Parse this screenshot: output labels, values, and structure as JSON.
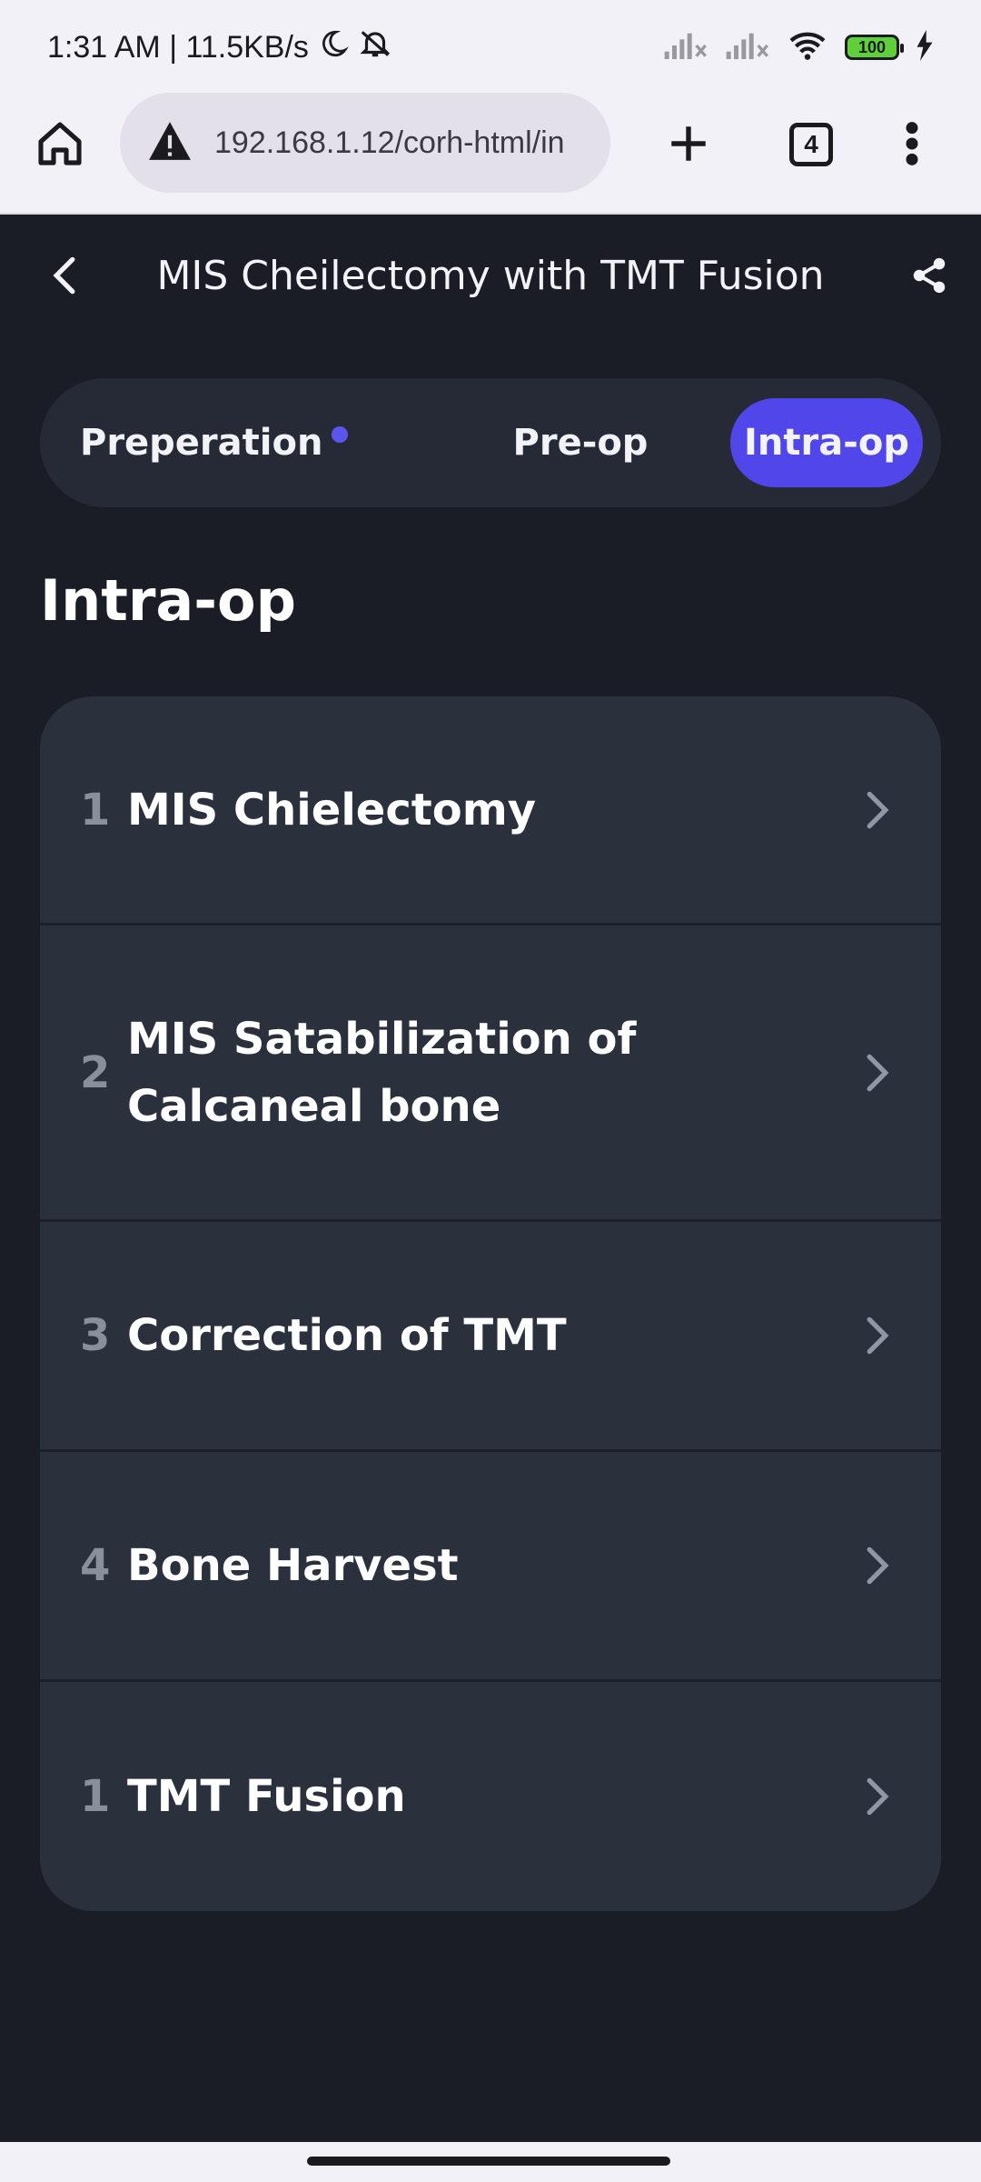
{
  "status_bar": {
    "time_speed": "1:31 AM | 11.5KB/s",
    "battery": "100"
  },
  "browser": {
    "url": "192.168.1.12/corh-html/in",
    "tab_count": "4"
  },
  "header": {
    "title": "MIS Cheilectomy with TMT Fusion"
  },
  "segments": [
    {
      "label": "Preperation",
      "has_dot": true
    },
    {
      "label": "Pre-op",
      "has_dot": false
    },
    {
      "label": "Intra-op",
      "active": true
    }
  ],
  "section": {
    "title": "Intra-op"
  },
  "steps": [
    {
      "number": "1",
      "label": "MIS Chielectomy"
    },
    {
      "number": "2",
      "label": "MIS Satabilization of Calcaneal bone"
    },
    {
      "number": "3",
      "label": "Correction of TMT"
    },
    {
      "number": "4",
      "label": "Bone Harvest"
    },
    {
      "number": "1",
      "label": "TMT Fusion"
    }
  ],
  "colors": {
    "background": "#1a1c26",
    "accent": "#5046ea",
    "card": "#2b303d"
  }
}
